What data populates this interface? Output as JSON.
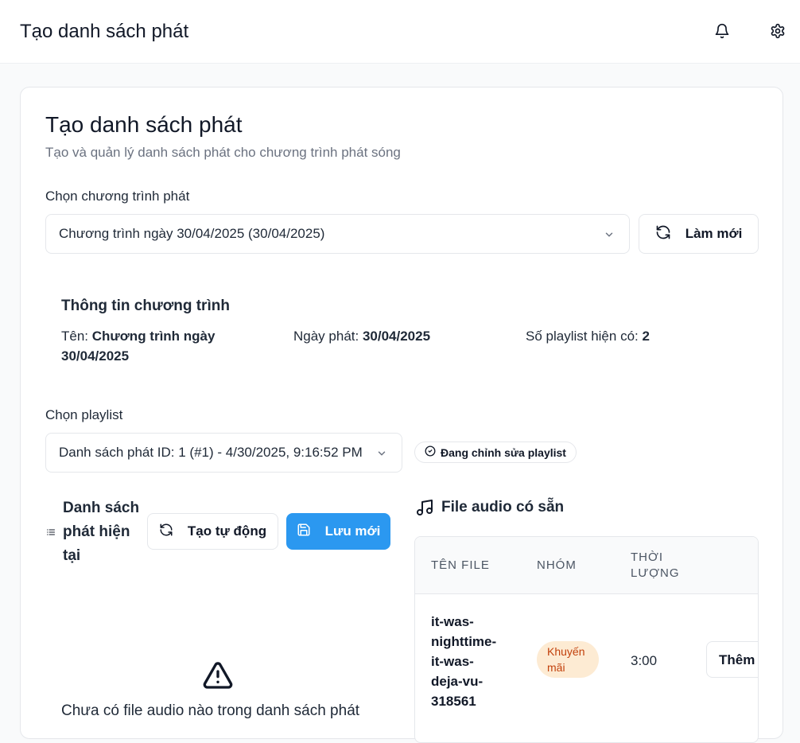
{
  "header": {
    "title": "Tạo danh sách phát",
    "notification_icon": "bell-icon",
    "settings_icon": "gear-icon"
  },
  "card": {
    "title": "Tạo danh sách phát",
    "subtitle": "Tạo và quản lý danh sách phát cho chương trình phát sóng"
  },
  "program_select": {
    "label": "Chọn chương trình phát",
    "value": "Chương trình ngày 30/04/2025 (30/04/2025)",
    "refresh_label": "Làm mới"
  },
  "program_info": {
    "title": "Thông tin chương trình",
    "name_label": "Tên: ",
    "name_value": "Chương trình ngày 30/04/2025",
    "date_label": "Ngày phát: ",
    "date_value": "30/04/2025",
    "count_label": "Số playlist hiện có: ",
    "count_value": "2"
  },
  "playlist_select": {
    "label": "Chọn playlist",
    "value": "Danh sách phát ID: 1 (#1) - 4/30/2025, 9:16:52 PM",
    "editing_badge": "Đang chỉnh sửa playlist"
  },
  "current_playlist": {
    "title": "Danh sách phát hiện tại",
    "auto_create_label": "Tạo tự động",
    "save_new_label": "Lưu mới",
    "empty_text": "Chưa có file audio nào trong danh sách phát"
  },
  "audio_files": {
    "title": "File audio có sẵn",
    "columns": [
      "TÊN FILE",
      "NHÓM",
      "THỜI LƯỢNG"
    ],
    "rows": [
      {
        "file": "it-was-nighttime-it-was-deja-vu-318561",
        "group": "Khuyến mãi",
        "duration": "3:00",
        "action": "Thêm"
      }
    ]
  }
}
